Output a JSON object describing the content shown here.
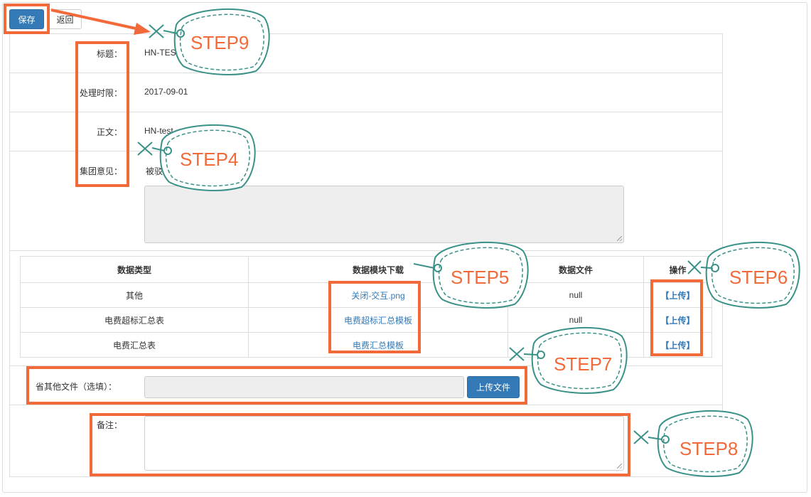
{
  "toolbar": {
    "save_label": "保存",
    "back_label": "返回"
  },
  "form": {
    "title_label": "标题：",
    "title_value": "HN-TES",
    "deadline_label": "处理时限：",
    "deadline_value": "2017-09-01",
    "body_label": "正文：",
    "body_value": "HN-test",
    "opinion_label": "集团意见：",
    "opinion_value": "被驳回"
  },
  "table": {
    "headers": [
      "数据类型",
      "数据模块下载",
      "数据文件",
      "操作"
    ],
    "rows": [
      {
        "type": "其他",
        "template": "关闭-交互.png",
        "file": "null",
        "action": "【上传】"
      },
      {
        "type": "电费超标汇总表",
        "template": "电费超标汇总模板",
        "file": "null",
        "action": "【上传】"
      },
      {
        "type": "电费汇总表",
        "template": "电费汇总模板",
        "file": "",
        "action": "【上传】"
      }
    ]
  },
  "other_files": {
    "label": "省其他文件（选填）：",
    "upload_button": "上传文件"
  },
  "remark": {
    "label": "备注："
  },
  "annotations": {
    "color_highlight": "#f26a3a",
    "color_tag": "#3a9188",
    "step9": "STEP9",
    "step4": "STEP4",
    "step5": "STEP5",
    "step6": "STEP6",
    "step7": "STEP7",
    "step8": "STEP8"
  }
}
